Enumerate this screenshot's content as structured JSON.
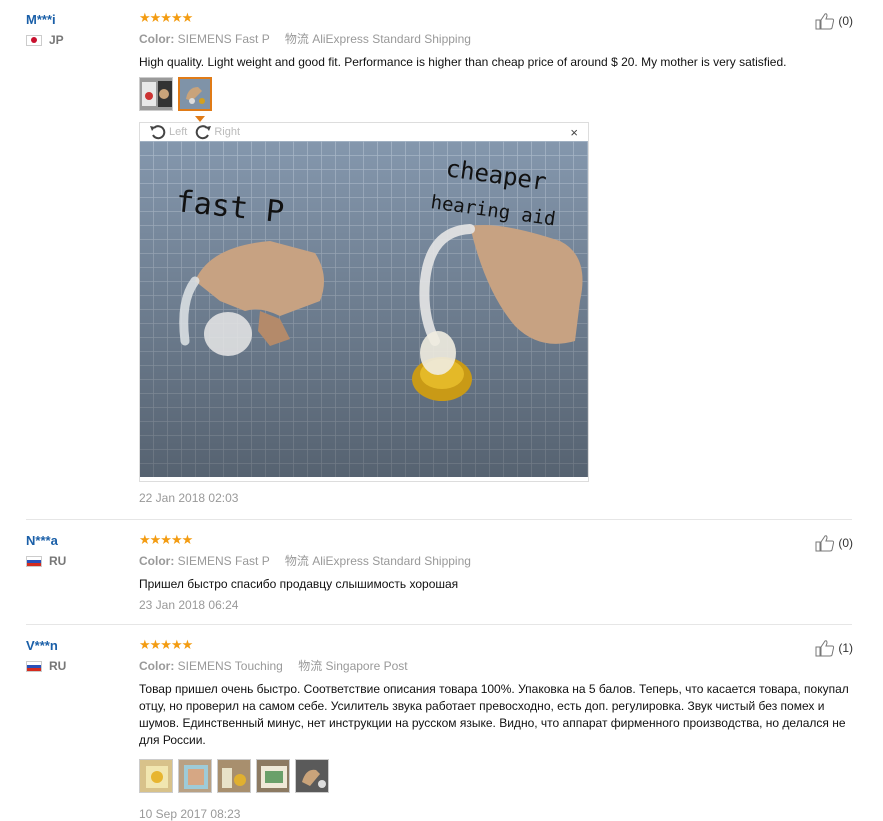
{
  "reviews": [
    {
      "user": "M***i",
      "country": "JP",
      "stars": "★★★★★",
      "color_label": "Color:",
      "color_value": "SIEMENS Fast P",
      "logistics_label": "物流",
      "shipping": "AliExpress Standard Shipping",
      "text": "High quality. Light weight and good fit. Performance is higher than cheap price of around $ 20. My mother is very satisfied.",
      "date": "22 Jan 2018 02:03",
      "helpful": "(0)"
    },
    {
      "user": "N***a",
      "country": "RU",
      "stars": "★★★★★",
      "color_label": "Color:",
      "color_value": "SIEMENS Fast P",
      "logistics_label": "物流",
      "shipping": "AliExpress Standard Shipping",
      "text": "Пришел быстро спасибо продавцу слышимость хорошая",
      "date": "23 Jan 2018 06:24",
      "helpful": "(0)"
    },
    {
      "user": "V***n",
      "country": "RU",
      "stars": "★★★★★",
      "color_label": "Color:",
      "color_value": "SIEMENS Touching",
      "logistics_label": "物流",
      "shipping": "Singapore Post",
      "text": "Товар пришел очень быстро. Соответствие описания товара 100%. Упаковка на 5 балов. Теперь, что касается товара, покупал отцу, но проверил на самом себе. Усилитель звука работает превосходно, есть доп. регулировка. Звук чистый без помех и шумов. Единственный минус, нет инструкции на русском языке. Видно, что аппарат фирменного производства, но делался не для России.",
      "date": "10 Sep 2017 08:23",
      "helpful": "(1)"
    }
  ],
  "viewer": {
    "left_label": "Left",
    "right_label": "Right",
    "close_label": "×",
    "photo_annotation_left": "fast P",
    "photo_annotation_right_1": "cheaper",
    "photo_annotation_right_2": "hearing aid"
  },
  "colors": {
    "username": "#1a5fa8",
    "stars": "#f39c12",
    "active_thumb": "#e07b17"
  }
}
